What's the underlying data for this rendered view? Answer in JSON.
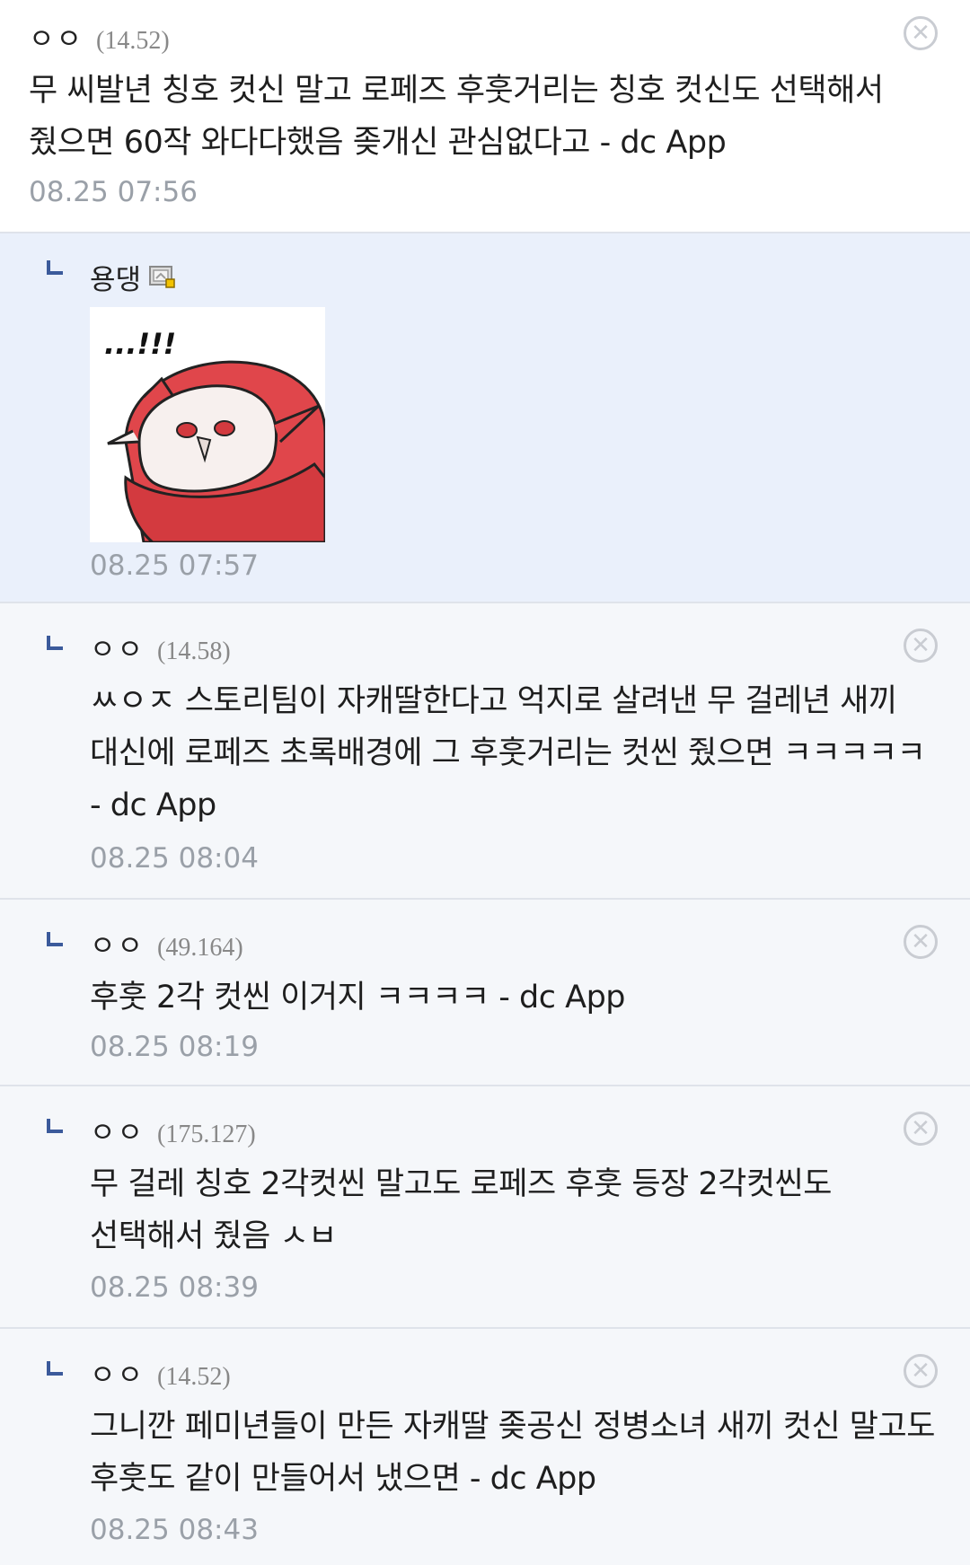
{
  "comments": [
    {
      "nick": "ㅇㅇ",
      "ip": "(14.52)",
      "text": "무 씨발년 칭호 컷신 말고 로페즈 후훗거리는 칭호 컷신도 선택해서 줬으면 60작 와다다했음 좆개신 관심없다고 - dc App",
      "time": "08.25 07:56"
    },
    {
      "nick": "용댕",
      "sticker_text": "...!!!",
      "time": "08.25 07:57"
    },
    {
      "nick": "ㅇㅇ",
      "ip": "(14.58)",
      "text": "ㅆㅇㅈ 스토리팀이 자캐딸한다고 억지로 살려낸 무 걸레년 새끼 대신에 로페즈 초록배경에 그 후훗거리는 컷씬 줬으면 ㅋㅋㅋㅋㅋ - dc App",
      "time": "08.25 08:04"
    },
    {
      "nick": "ㅇㅇ",
      "ip": "(49.164)",
      "text": "후훗 2각 컷씬 이거지 ㅋㅋㅋㅋ - dc App",
      "time": "08.25 08:19"
    },
    {
      "nick": "ㅇㅇ",
      "ip": "(175.127)",
      "text": "무 걸레 칭호 2각컷씬 말고도 로페즈 후훗 등장 2각컷씬도 선택해서 줬음 ㅅㅂ",
      "time": "08.25 08:39"
    },
    {
      "nick": "ㅇㅇ",
      "ip": "(14.52)",
      "text": "그니깐 페미년들이 만든 자캐딸 좆공신 정병소녀 새끼 컷신 말고도 후훗도 같이 만들어서 냈으면 - dc App",
      "time": "08.25 08:43"
    }
  ],
  "icons": {
    "close": "close-circle-icon",
    "reply": "reply-arrow-icon",
    "gallog": "gallog-badge-icon"
  },
  "colors": {
    "reply_mark": "#3b5a9b",
    "highlight_bg": "#eaf0fb",
    "reply_bg": "#f5f7fa",
    "sticker_red": "#e0464b"
  }
}
